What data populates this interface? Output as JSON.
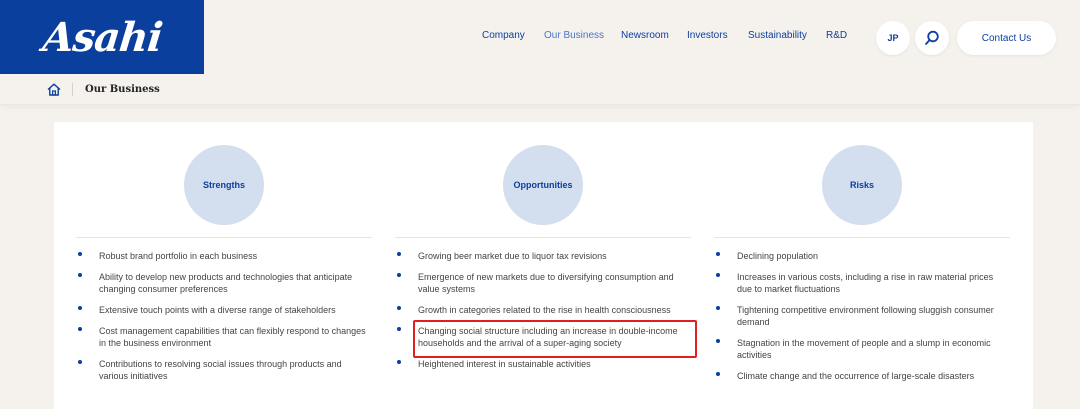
{
  "header": {
    "logo_text": "Asahi",
    "nav": {
      "company": "Company",
      "our_business": "Our Business",
      "newsroom": "Newsroom",
      "investors": "Investors",
      "sustainability": "Sustainability",
      "rd": "R&D"
    },
    "lang_label": "JP",
    "search_icon": "search-icon",
    "contact_label": "Contact Us",
    "colors": {
      "brand_blue": "#0a3f9e",
      "active_nav": "#4a76c8",
      "background": "#f5f2ed"
    }
  },
  "breadcrumb": {
    "home_icon": "home-icon",
    "current": "Our Business"
  },
  "swot": {
    "strengths": {
      "title": "Strengths",
      "items": [
        "Robust brand portfolio in each business",
        "Ability to develop new products and technologies that anticipate changing consumer preferences",
        "Extensive touch points with a diverse range of stakeholders",
        "Cost management capabilities that can flexibly respond to changes in the business environment",
        "Contributions to resolving social issues through products and various initiatives"
      ]
    },
    "opportunities": {
      "title": "Opportunities",
      "items": [
        "Growing beer market due to liquor tax revisions",
        "Emergence of new markets due to diversifying consumption and value systems",
        "Growth in categories related to the rise in health consciousness",
        "Changing social structure including an increase in double-income households and the arrival of a super-aging society",
        "Heightened interest in sustainable activities"
      ]
    },
    "risks": {
      "title": "Risks",
      "items": [
        "Declining population",
        "Increases in various costs, including a rise in raw material prices due to market fluctuations",
        "Tightening competitive environment following sluggish consumer demand",
        "Stagnation in the movement of people and a slump in economic activities",
        "Climate change and the occurrence of large-scale disasters"
      ]
    },
    "highlight_color": "#e02020"
  }
}
